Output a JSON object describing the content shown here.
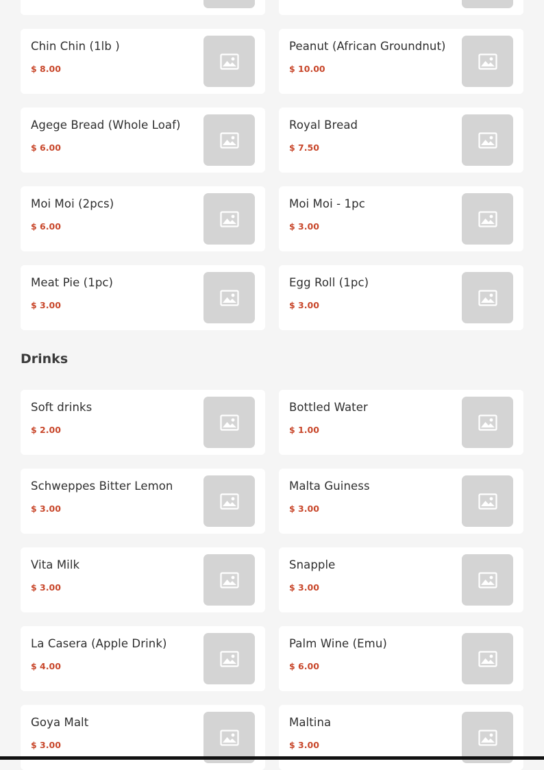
{
  "currency": "$",
  "sections": [
    {
      "items": [
        {
          "name": "",
          "price": ""
        },
        {
          "name": "",
          "price": ""
        },
        {
          "name": "Chin Chin (1lb )",
          "price": "$ 8.00"
        },
        {
          "name": "Peanut (African Groundnut)",
          "price": "$ 10.00"
        },
        {
          "name": "Agege Bread (Whole Loaf)",
          "price": "$ 6.00"
        },
        {
          "name": "Royal Bread",
          "price": "$ 7.50"
        },
        {
          "name": "Moi Moi (2pcs)",
          "price": "$ 6.00"
        },
        {
          "name": "Moi Moi - 1pc",
          "price": "$ 3.00"
        },
        {
          "name": "Meat Pie (1pc)",
          "price": "$ 3.00"
        },
        {
          "name": "Egg Roll (1pc)",
          "price": "$ 3.00"
        }
      ]
    },
    {
      "title": "Drinks",
      "items": [
        {
          "name": "Soft drinks",
          "price": "$ 2.00"
        },
        {
          "name": "Bottled Water",
          "price": "$ 1.00"
        },
        {
          "name": "Schweppes Bitter Lemon",
          "price": "$ 3.00"
        },
        {
          "name": "Malta Guiness",
          "price": "$ 3.00"
        },
        {
          "name": "Vita Milk",
          "price": "$ 3.00"
        },
        {
          "name": "Snapple",
          "price": "$ 3.00"
        },
        {
          "name": "La Casera (Apple Drink)",
          "price": "$ 4.00"
        },
        {
          "name": "Palm Wine (Emu)",
          "price": "$ 6.00"
        },
        {
          "name": "Goya Malt",
          "price": "$ 3.00"
        },
        {
          "name": "Maltina",
          "price": "$ 3.00"
        }
      ]
    }
  ],
  "colors": {
    "price": "#c8472b",
    "card": "#ffffff",
    "background": "#f5f5f5",
    "placeholder": "#d4d4d4"
  },
  "icons": {
    "thumbnail": "image-placeholder-icon"
  }
}
